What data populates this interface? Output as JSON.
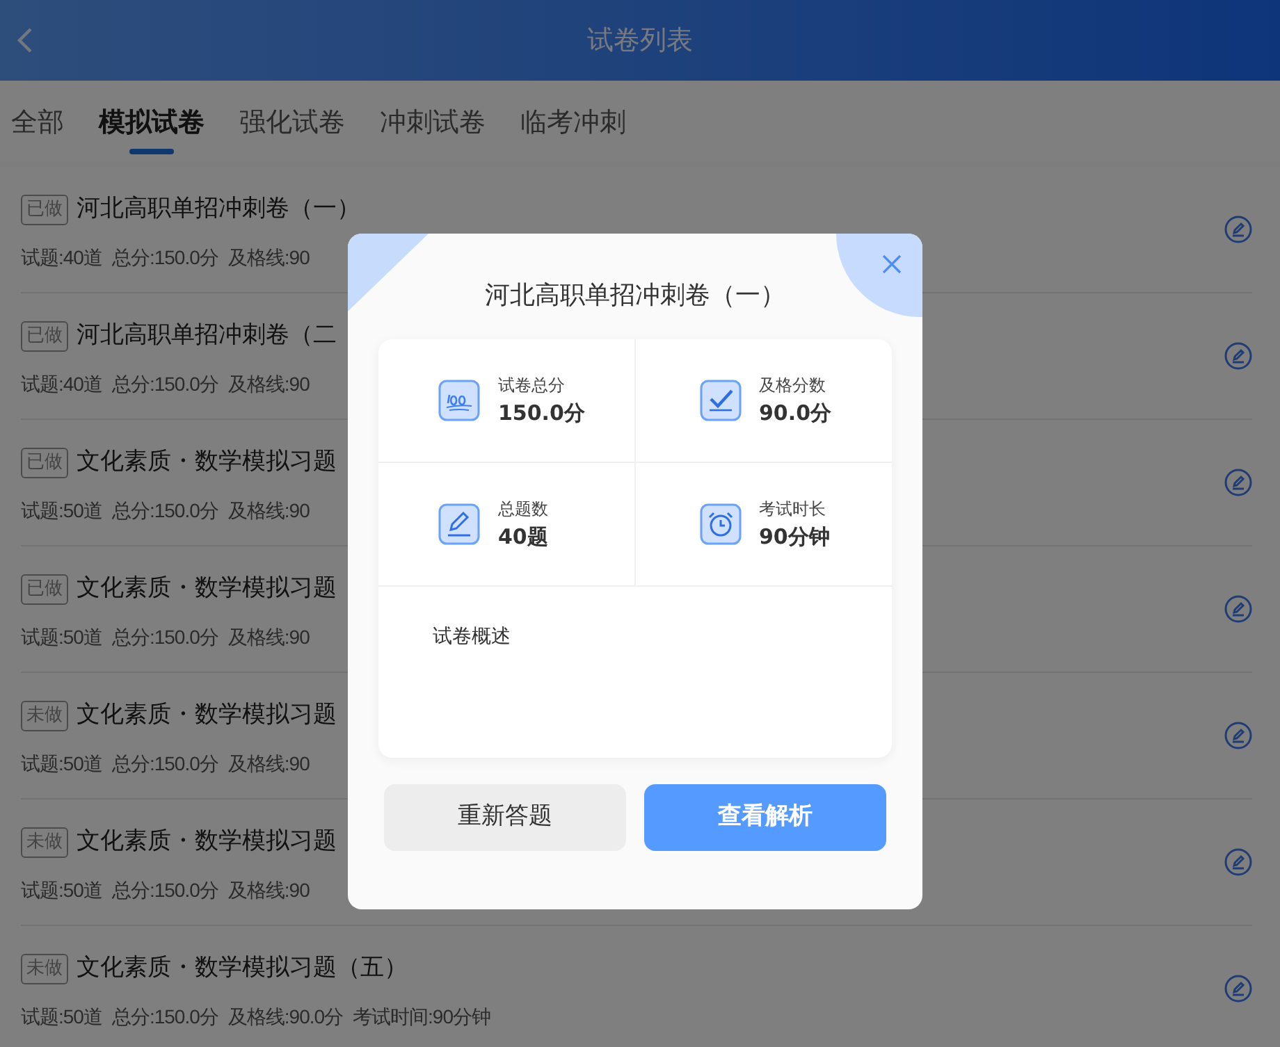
{
  "header": {
    "title": "试卷列表"
  },
  "tabs": [
    {
      "label": "全部",
      "selected": false
    },
    {
      "label": "模拟试卷",
      "selected": true
    },
    {
      "label": "强化试卷",
      "selected": false
    },
    {
      "label": "冲刺试卷",
      "selected": false
    },
    {
      "label": "临考冲刺",
      "selected": false
    }
  ],
  "papers": [
    {
      "status": "已做",
      "title": "河北高职单招冲刺卷（一）",
      "meta": [
        "试题:40道",
        "总分:150.0分",
        "及格线:90"
      ]
    },
    {
      "status": "已做",
      "title": "河北高职单招冲刺卷（二",
      "meta": [
        "试题:40道",
        "总分:150.0分",
        "及格线:90"
      ]
    },
    {
      "status": "已做",
      "title": "文化素质・数学模拟习题",
      "meta": [
        "试题:50道",
        "总分:150.0分",
        "及格线:90"
      ]
    },
    {
      "status": "已做",
      "title": "文化素质・数学模拟习题",
      "meta": [
        "试题:50道",
        "总分:150.0分",
        "及格线:90"
      ]
    },
    {
      "status": "未做",
      "title": "文化素质・数学模拟习题",
      "meta": [
        "试题:50道",
        "总分:150.0分",
        "及格线:90"
      ]
    },
    {
      "status": "未做",
      "title": "文化素质・数学模拟习题",
      "meta": [
        "试题:50道",
        "总分:150.0分",
        "及格线:90"
      ]
    },
    {
      "status": "未做",
      "title": "文化素质・数学模拟习题（五）",
      "meta": [
        "试题:50道",
        "总分:150.0分",
        "及格线:90.0分",
        "考试时间:90分钟"
      ]
    }
  ],
  "modal": {
    "title": "河北高职单招冲刺卷（一）",
    "stats": [
      {
        "kind": "score",
        "label": "试卷总分",
        "value": "150.0分"
      },
      {
        "kind": "pass",
        "label": "及格分数",
        "value": "90.0分"
      },
      {
        "kind": "count",
        "label": "总题数",
        "value": "40题"
      },
      {
        "kind": "time",
        "label": "考试时长",
        "value": "90分钟"
      }
    ],
    "overview_label": "试卷概述",
    "buttons": [
      {
        "kind": "secondary",
        "label": "重新答题"
      },
      {
        "kind": "primary",
        "label": "查看解析"
      }
    ]
  }
}
